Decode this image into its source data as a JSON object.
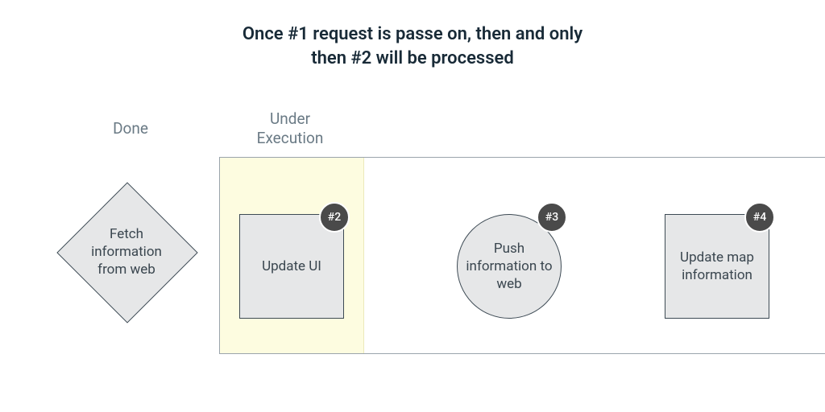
{
  "title_line1": "Once #1 request is passe on, then and only",
  "title_line2": "then #2 will be processed",
  "labels": {
    "done": "Done",
    "under_execution_line1": "Under",
    "under_execution_line2": "Execution"
  },
  "done_task": {
    "text": "Fetch information from web"
  },
  "queue": [
    {
      "badge": "#2",
      "label": "Update UI",
      "shape": "square"
    },
    {
      "badge": "#3",
      "label": "Push information to web",
      "shape": "circle"
    },
    {
      "badge": "#4",
      "label": "Update map information",
      "shape": "square"
    }
  ]
}
